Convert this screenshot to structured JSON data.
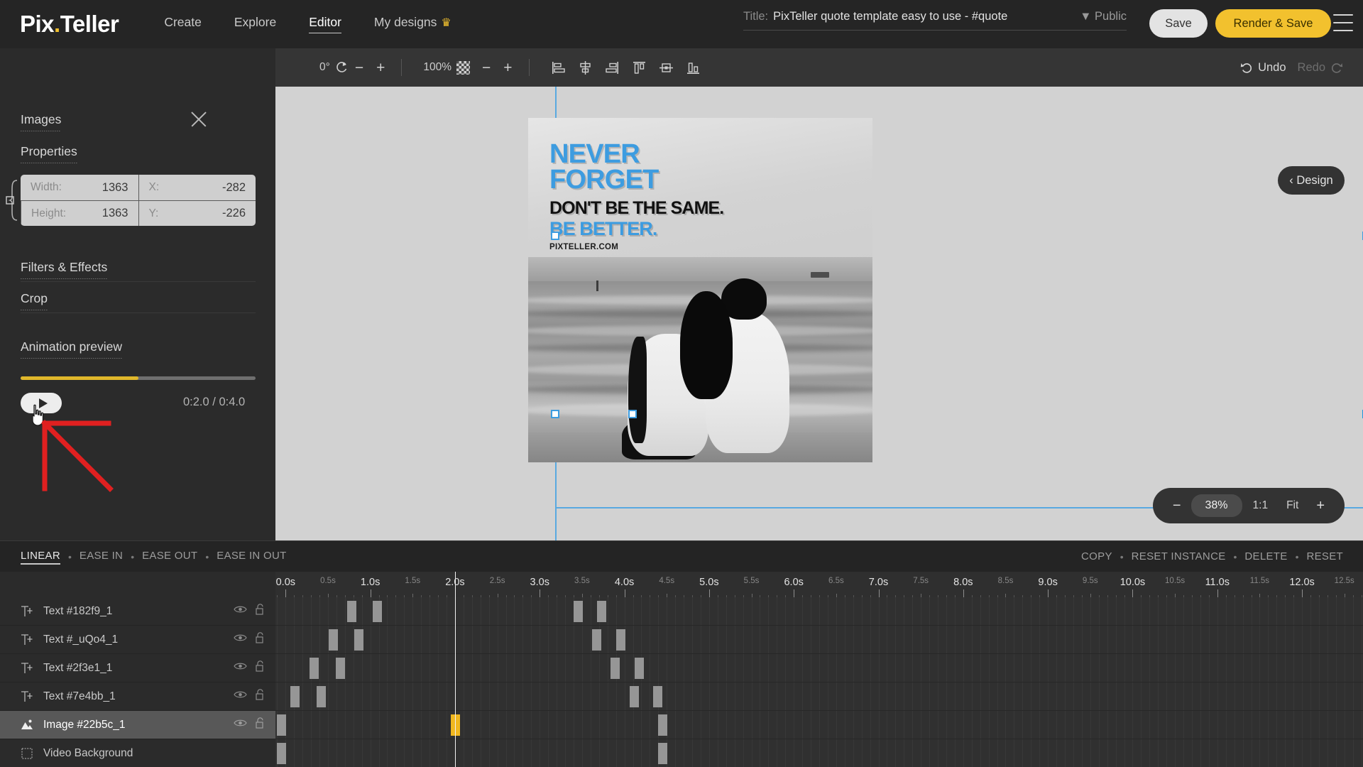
{
  "nav": {
    "logo_pix": "Pix",
    "logo_teller": "Teller",
    "links": [
      {
        "label": "Create",
        "active": false,
        "crown": false
      },
      {
        "label": "Explore",
        "active": false,
        "crown": false
      },
      {
        "label": "Editor",
        "active": true,
        "crown": false
      },
      {
        "label": "My designs",
        "active": false,
        "crown": true
      }
    ],
    "crown_glyph": "♛",
    "title_label": "Title:",
    "title_value": "PixTeller quote template easy to use - #quote",
    "visibility": "▼ Public",
    "save_label": "Save",
    "render_label": "Render & Save"
  },
  "optbar": {
    "rotation_value": "0°",
    "rotate_icon": "rotate-cw-icon",
    "rotate_minus": "−",
    "rotate_plus": "+",
    "opacity_value": "100%",
    "opacity_icon": "checkerboard-icon",
    "opacity_minus": "−",
    "opacity_plus": "+",
    "align_icons": [
      "align-left-icon",
      "align-center-horizontal-icon",
      "align-right-icon",
      "align-top-icon",
      "align-middle-vertical-icon",
      "align-bottom-icon"
    ],
    "undo_label": "Undo",
    "redo_label": "Redo"
  },
  "panel": {
    "section_images": "Images",
    "section_properties": "Properties",
    "close_icon": "close-icon",
    "fields": [
      {
        "label": "Width:",
        "value": "1363"
      },
      {
        "label": "X:",
        "value": "-282"
      },
      {
        "label": "Height:",
        "value": "1363"
      },
      {
        "label": "Y:",
        "value": "-226"
      }
    ],
    "section_filters": "Filters & Effects",
    "section_crop": "Crop",
    "section_animation": "Animation preview",
    "play_icon": "play-icon",
    "timecode": "0:2.0 / 0:4.0",
    "progress_percent": 50,
    "cursor_icon": "hand-pointer-cursor",
    "annotation_icon": "red-arrow-annotation"
  },
  "canvas": {
    "design_tab_label": "‹ Design",
    "zoom": {
      "minus": "−",
      "value": "38%",
      "one_to_one": "1:1",
      "fit": "Fit",
      "plus": "+"
    },
    "poster": {
      "line1": "NEVER",
      "line2": "FORGET",
      "line3": "DON'T BE THE SAME.",
      "line4": "BE BETTER.",
      "line5": "PIXTELLER.COM",
      "accent_color": "#3d9ce0",
      "dark_color": "#111111"
    },
    "selection_color": "#3d9ce0"
  },
  "easing": {
    "options": [
      {
        "label": "LINEAR",
        "active": true
      },
      {
        "label": "EASE IN",
        "active": false
      },
      {
        "label": "EASE OUT",
        "active": false
      },
      {
        "label": "EASE IN OUT",
        "active": false
      }
    ],
    "actions": [
      "COPY",
      "RESET INSTANCE",
      "DELETE",
      "RESET"
    ],
    "separator": "•"
  },
  "timeline": {
    "ruler_labels": [
      {
        "t": 0.0,
        "label": "0.0s",
        "major": true
      },
      {
        "t": 0.5,
        "label": "0.5s",
        "major": false
      },
      {
        "t": 1.0,
        "label": "1.0s",
        "major": true
      },
      {
        "t": 1.5,
        "label": "1.5s",
        "major": false
      },
      {
        "t": 2.0,
        "label": "2.0s",
        "major": true
      },
      {
        "t": 2.5,
        "label": "2.5s",
        "major": false
      },
      {
        "t": 3.0,
        "label": "3.0s",
        "major": true
      },
      {
        "t": 3.5,
        "label": "3.5s",
        "major": false
      },
      {
        "t": 4.0,
        "label": "4.0s",
        "major": true
      },
      {
        "t": 4.5,
        "label": "4.5s",
        "major": false
      },
      {
        "t": 5.0,
        "label": "5.0s",
        "major": true
      },
      {
        "t": 5.5,
        "label": "5.5s",
        "major": false
      },
      {
        "t": 6.0,
        "label": "6.0s",
        "major": true
      },
      {
        "t": 6.5,
        "label": "6.5s",
        "major": false
      },
      {
        "t": 7.0,
        "label": "7.0s",
        "major": true
      },
      {
        "t": 7.5,
        "label": "7.5s",
        "major": false
      },
      {
        "t": 8.0,
        "label": "8.0s",
        "major": true
      },
      {
        "t": 8.5,
        "label": "8.5s",
        "major": false
      },
      {
        "t": 9.0,
        "label": "9.0s",
        "major": true
      },
      {
        "t": 9.5,
        "label": "9.5s",
        "major": false
      },
      {
        "t": 10.0,
        "label": "10.0s",
        "major": true
      },
      {
        "t": 10.5,
        "label": "10.5s",
        "major": false
      },
      {
        "t": 11.0,
        "label": "11.0s",
        "major": true
      },
      {
        "t": 11.5,
        "label": "11.5s",
        "major": false
      },
      {
        "t": 12.0,
        "label": "12.0s",
        "major": true
      },
      {
        "t": 12.5,
        "label": "12.5s",
        "major": false
      }
    ],
    "time_start": -0.12,
    "time_end": 12.72,
    "playhead_time": 2.0,
    "layers": [
      {
        "name": "Text #182f9_1",
        "icon": "text-layer-icon",
        "selected": false,
        "visibility_icon": "eye-icon",
        "lock_icon": "unlock-icon",
        "keyframes": [
          0.78,
          1.08,
          3.45,
          3.73
        ]
      },
      {
        "name": "Text #_uQo4_1",
        "icon": "text-layer-icon",
        "selected": false,
        "visibility_icon": "eye-icon",
        "lock_icon": "unlock-icon",
        "keyframes": [
          0.56,
          0.86,
          3.67,
          3.95
        ]
      },
      {
        "name": "Text #2f3e1_1",
        "icon": "text-layer-icon",
        "selected": false,
        "visibility_icon": "eye-icon",
        "lock_icon": "unlock-icon",
        "keyframes": [
          0.33,
          0.64,
          3.89,
          4.17
        ]
      },
      {
        "name": "Text #7e4bb_1",
        "icon": "text-layer-icon",
        "selected": false,
        "visibility_icon": "eye-icon",
        "lock_icon": "unlock-icon",
        "keyframes": [
          0.11,
          0.42,
          4.11,
          4.39
        ]
      },
      {
        "name": "Image #22b5c_1",
        "icon": "image-layer-icon",
        "selected": true,
        "visibility_icon": "eye-icon",
        "lock_icon": "unlock-icon",
        "keyframes": [
          -0.05,
          4.45
        ],
        "current_keyframe": 2.0
      },
      {
        "name": "Video Background",
        "icon": "video-background-icon",
        "selected": false,
        "visibility_icon": null,
        "lock_icon": null,
        "keyframes": [
          -0.05,
          4.45
        ]
      }
    ]
  }
}
